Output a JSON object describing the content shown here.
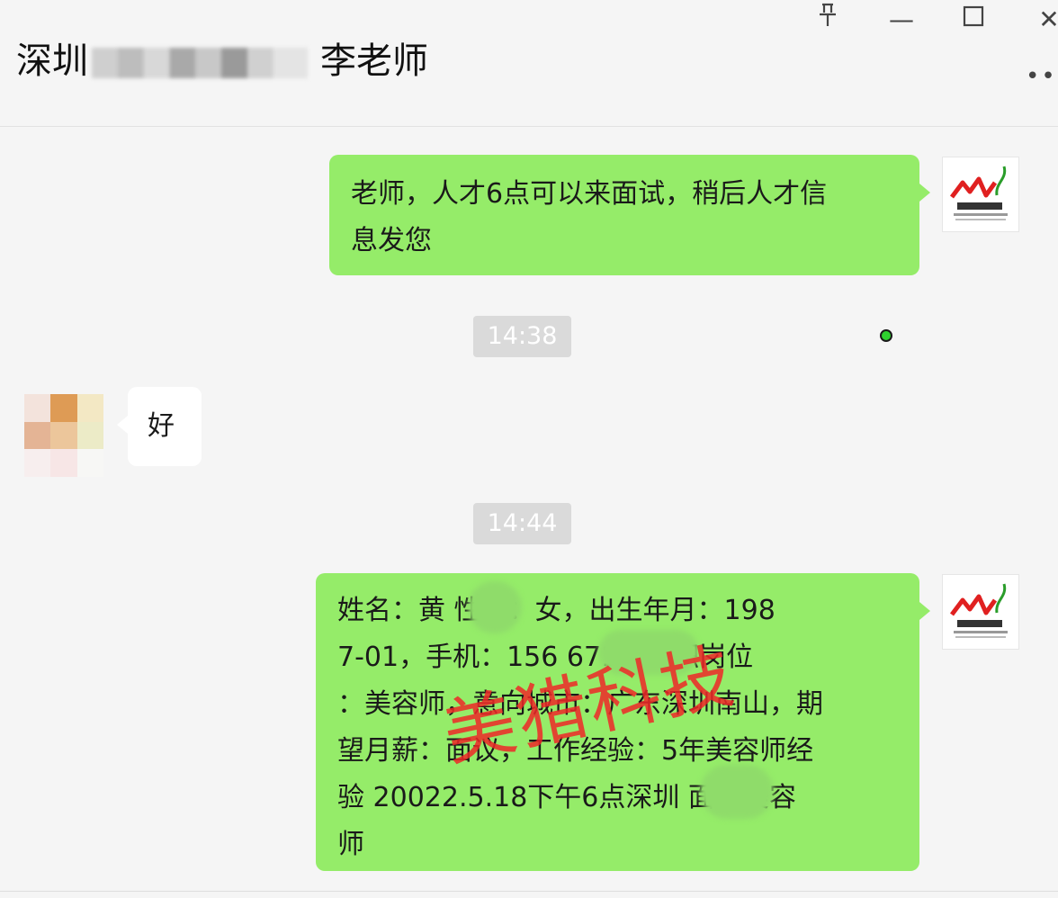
{
  "window": {
    "title_prefix": "深圳",
    "contact_name": "李老师",
    "controls": {
      "pin": "⚲",
      "minimize": "—",
      "maximize": "☐",
      "close": "✕",
      "more": "••"
    }
  },
  "messages": [
    {
      "direction": "outgoing",
      "lines": [
        "老师，人才6点可以来面试，稍后人才信",
        "息发您"
      ]
    },
    {
      "direction": "incoming",
      "text": "好"
    },
    {
      "direction": "outgoing",
      "lines": [
        "姓名：黄    性别：女，出生年月：198",
        "7-01，手机：156          671，求职岗位",
        "：美容师，意向城市：广东深圳南山，期",
        "望月薪：面议，工作经验：5年美容师经",
        "验 20022.5.18下午6点深圳     面试美容",
        "师"
      ]
    }
  ],
  "timestamps": [
    "14:38",
    "14:44"
  ],
  "watermark": "美猎科技",
  "colors": {
    "outgoing_bubble": "#95ec69",
    "incoming_bubble": "#ffffff",
    "timestamp_bg": "#dadada",
    "watermark": "#ee2828",
    "online_dot": "#2fd12f"
  },
  "icons": {
    "shop_avatar": "meilie-logo-icon",
    "user_avatar": "pixelated-avatar-icon",
    "pin": "pin-icon",
    "minimize": "minimize-icon",
    "maximize": "maximize-icon",
    "close": "close-icon",
    "more": "more-icon"
  }
}
